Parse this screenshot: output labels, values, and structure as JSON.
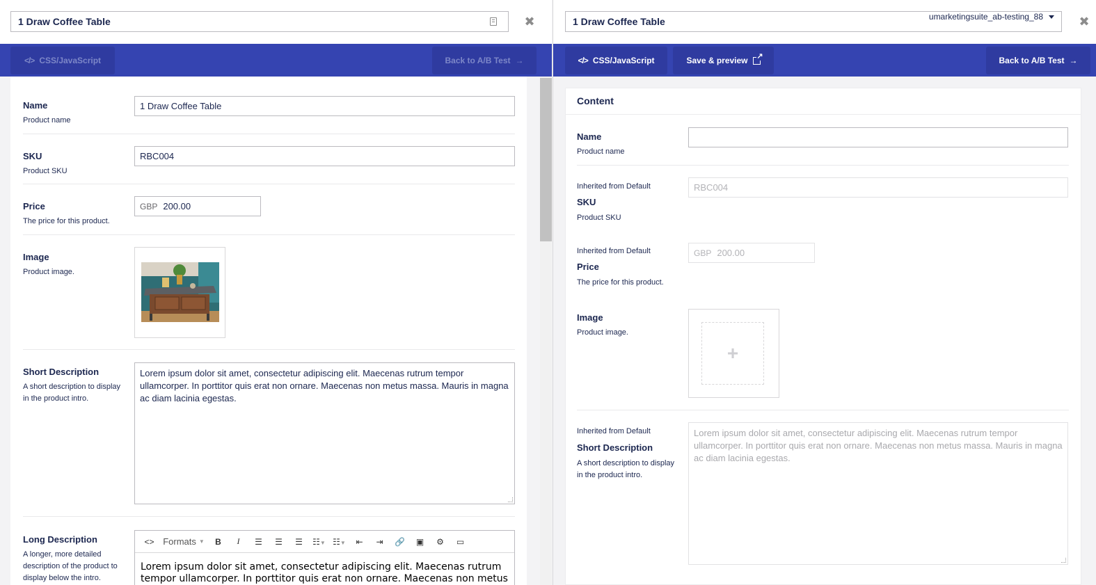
{
  "left": {
    "title": "1 Draw Coffee Table",
    "btn_css": "CSS/JavaScript",
    "btn_back": "Back to A/B Test",
    "fields": {
      "name_label": "Name",
      "name_desc": "Product name",
      "name_value": "1 Draw Coffee Table",
      "sku_label": "SKU",
      "sku_desc": "Product SKU",
      "sku_value": "RBC004",
      "price_label": "Price",
      "price_desc": "The price for this product.",
      "price_currency": "GBP",
      "price_value": "200.00",
      "image_label": "Image",
      "image_desc": "Product image.",
      "short_label": "Short Description",
      "short_desc": "A short description to display in the product intro.",
      "short_value": "Lorem ipsum dolor sit amet, consectetur adipiscing elit. Maecenas rutrum tempor ullamcorper. In porttitor quis erat non ornare. Maecenas non metus massa. Mauris in magna ac diam lacinia egestas.",
      "long_label": "Long Description",
      "long_desc": "A longer, more detailed description of the product to display below the intro.",
      "long_value": "Lorem ipsum dolor sit amet, consectetur adipiscing elit. Maecenas rutrum tempor ullamcorper. In porttitor quis erat non ornare. Maecenas non metus",
      "rte_formats": "Formats"
    }
  },
  "right": {
    "title": "1 Draw Coffee Table",
    "variant": "umarketingsuite_ab-testing_88",
    "btn_css": "CSS/JavaScript",
    "btn_save": "Save & preview",
    "btn_back": "Back to A/B Test",
    "panel_title": "Content",
    "inherited": "Inherited from Default",
    "fields": {
      "name_label": "Name",
      "name_desc": "Product name",
      "name_value": "",
      "sku_label": "SKU",
      "sku_desc": "Product SKU",
      "sku_value": "RBC004",
      "price_label": "Price",
      "price_desc": "The price for this product.",
      "price_currency": "GBP",
      "price_value": "200.00",
      "image_label": "Image",
      "image_desc": "Product image.",
      "short_label": "Short Description",
      "short_desc": "A short description to display in the product intro.",
      "short_value": "Lorem ipsum dolor sit amet, consectetur adipiscing elit. Maecenas rutrum tempor ullamcorper. In porttitor quis erat non ornare. Maecenas non metus massa. Mauris in magna ac diam lacinia egestas."
    }
  },
  "icons": {
    "doc": "document-icon",
    "close": "close-icon",
    "code": "code-icon",
    "arrow": "arrow-right-icon",
    "external": "external-link-icon",
    "plus": "plus-icon",
    "caret": "chevron-down-icon"
  }
}
